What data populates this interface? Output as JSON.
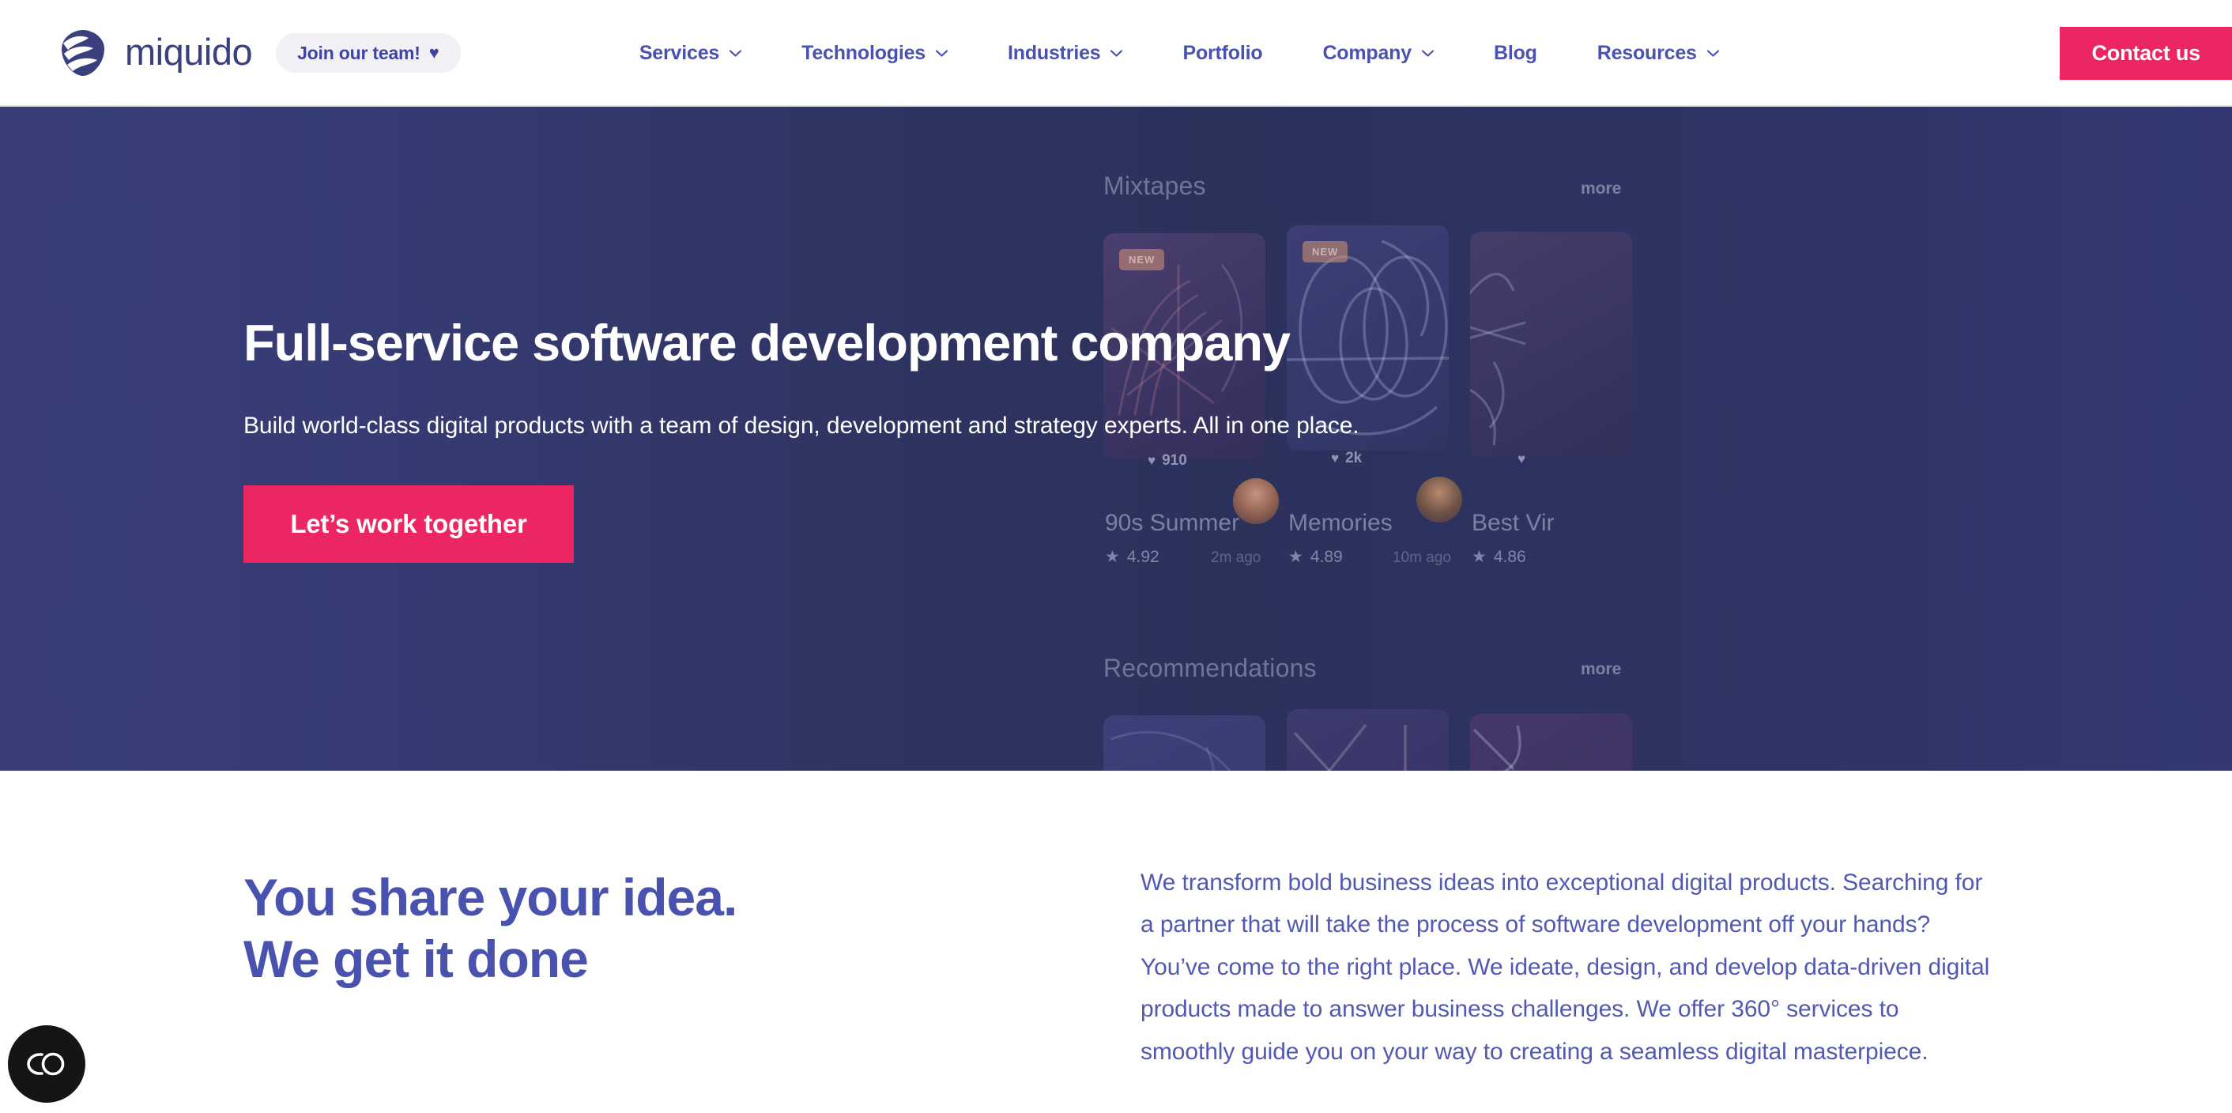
{
  "header": {
    "logo_text": "miquido",
    "logo_icon": "miquido-logo-icon",
    "join_badge": {
      "label": "Join our team!",
      "icon": "heart-icon"
    },
    "nav": [
      {
        "label": "Services",
        "has_dropdown": true,
        "icon": "chevron-down-icon"
      },
      {
        "label": "Technologies",
        "has_dropdown": true,
        "icon": "chevron-down-icon"
      },
      {
        "label": "Industries",
        "has_dropdown": true,
        "icon": "chevron-down-icon"
      },
      {
        "label": "Portfolio",
        "has_dropdown": false,
        "icon": ""
      },
      {
        "label": "Company",
        "has_dropdown": true,
        "icon": "chevron-down-icon"
      },
      {
        "label": "Blog",
        "has_dropdown": false,
        "icon": ""
      },
      {
        "label": "Resources",
        "has_dropdown": true,
        "icon": "chevron-down-icon"
      }
    ],
    "contact_button": "Contact us"
  },
  "hero": {
    "title": "Full-service software development company",
    "subtitle": "Build world-class digital products with a team of design, development and strategy experts. All in one place.",
    "cta_label": "Let’s work together",
    "mockup": {
      "sections": [
        {
          "title": "Mixtapes",
          "more_label": "more"
        },
        {
          "title": "Recommendations",
          "more_label": "more"
        }
      ],
      "cards": [
        {
          "badge": "NEW",
          "likes": "910",
          "like_icon": "heart-icon",
          "name": "90s Summer",
          "rating": "4.92",
          "rating_icon": "star-icon",
          "time": "2m ago"
        },
        {
          "badge": "NEW",
          "likes": "2k",
          "like_icon": "heart-icon",
          "name": "Memories",
          "rating": "4.89",
          "rating_icon": "star-icon",
          "time": "10m ago"
        },
        {
          "badge": "",
          "likes": "",
          "like_icon": "heart-icon",
          "name": "Best Vir",
          "rating": "4.86",
          "rating_icon": "star-icon",
          "time": ""
        }
      ]
    }
  },
  "section2": {
    "heading_line1": "You share your idea.",
    "heading_line2": "We get it done",
    "body": "We transform bold business ideas into exceptional digital products. Searching for a partner that will take the process of software development off your hands? You’ve come to the right place. We ideate, design, and develop data-driven digital products made to answer business challenges. We offer 360° services to smoothly guide you on your way to creating a seamless digital masterpiece."
  },
  "cookie_widget": {
    "icon": "cookie-consent-toggle-icon"
  },
  "colors": {
    "brand_purple": "#3a3f7d",
    "nav_purple": "#4a52b0",
    "accent_pink": "#ec2663",
    "hero_gradient_left": "#393e77",
    "hero_gradient_mid": "#2c315c",
    "hero_gradient_right": "#333873",
    "body_text_purple": "#5159b3",
    "join_pill_bg": "#f1f1f5",
    "widget_black": "#151515"
  }
}
